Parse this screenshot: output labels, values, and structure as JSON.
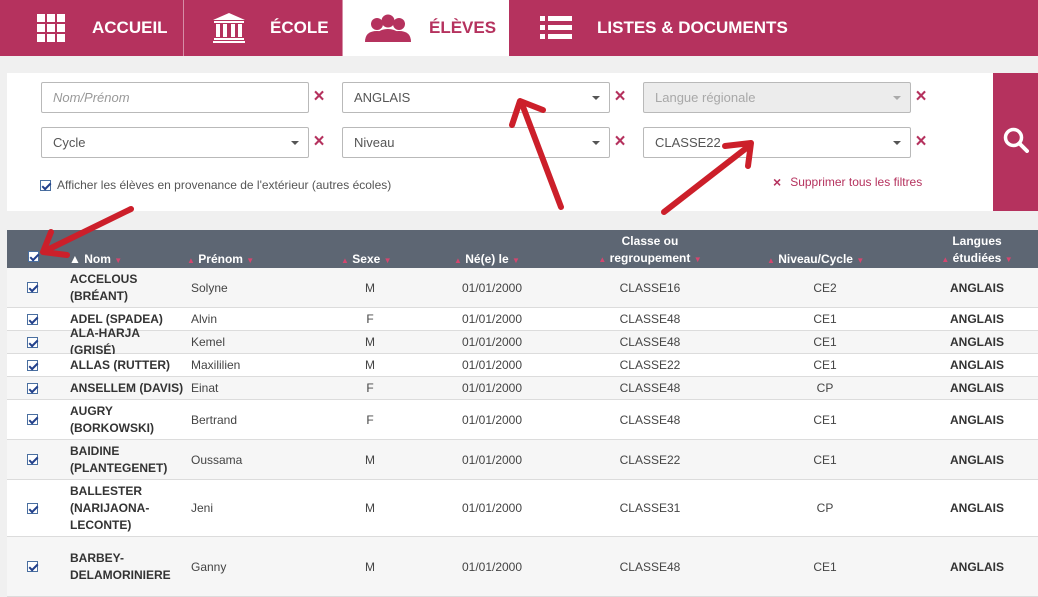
{
  "nav": {
    "tabs": [
      {
        "label": "ACCUEIL",
        "icon": "grid-icon"
      },
      {
        "label": "ÉCOLE",
        "icon": "school-building-icon"
      },
      {
        "label": "ÉLÈVES",
        "icon": "students-icon",
        "active": true
      },
      {
        "label": "LISTES & DOCUMENTS",
        "icon": "list-icon"
      }
    ]
  },
  "filters": {
    "name_placeholder": "Nom/Prénom",
    "language_value": "ANGLAIS",
    "regional_language_placeholder": "Langue régionale",
    "cycle_placeholder": "Cycle",
    "niveau_placeholder": "Niveau",
    "class_value": "CLASSE22",
    "external_label": "Afficher les élèves en provenance de l'extérieur (autres écoles)",
    "external_checked": true,
    "clear_all_label": "Supprimer tous les filtres"
  },
  "table": {
    "headers": {
      "nom": "Nom",
      "prenom": "Prénom",
      "sexe": "Sexe",
      "ne_le": "Né(e) le",
      "classe_line1": "Classe ou",
      "classe_line2": "regroupement",
      "niveau": "Niveau/Cycle",
      "langues_line1": "Langues",
      "langues_line2": "étudiées"
    },
    "rows": [
      {
        "nom": "ACCELOUS (BRÉANT)",
        "prenom": "Solyne",
        "sexe": "M",
        "ne_le": "01/01/2000",
        "classe": "CLASSE16",
        "niveau": "CE2",
        "langues": "ANGLAIS"
      },
      {
        "nom": "ADEL (SPADEA)",
        "prenom": "Alvin",
        "sexe": "F",
        "ne_le": "01/01/2000",
        "classe": "CLASSE48",
        "niveau": "CE1",
        "langues": "ANGLAIS"
      },
      {
        "nom": "ALA-HARJA (GRISÉ)",
        "prenom": "Kemel",
        "sexe": "M",
        "ne_le": "01/01/2000",
        "classe": "CLASSE48",
        "niveau": "CE1",
        "langues": "ANGLAIS"
      },
      {
        "nom": "ALLAS (RUTTER)",
        "prenom": "Maxililien",
        "sexe": "M",
        "ne_le": "01/01/2000",
        "classe": "CLASSE22",
        "niveau": "CE1",
        "langues": "ANGLAIS"
      },
      {
        "nom": "ANSELLEM (DAVIS)",
        "prenom": "Einat",
        "sexe": "F",
        "ne_le": "01/01/2000",
        "classe": "CLASSE48",
        "niveau": "CP",
        "langues": "ANGLAIS"
      },
      {
        "nom": "AUGRY (BORKOWSKI)",
        "prenom": "Bertrand",
        "sexe": "F",
        "ne_le": "01/01/2000",
        "classe": "CLASSE48",
        "niveau": "CE1",
        "langues": "ANGLAIS"
      },
      {
        "nom": "BAIDINE (PLANTEGENET)",
        "prenom": "Oussama",
        "sexe": "M",
        "ne_le": "01/01/2000",
        "classe": "CLASSE22",
        "niveau": "CE1",
        "langues": "ANGLAIS"
      },
      {
        "nom": "BALLESTER (NARIJAONA-LECONTE)",
        "prenom": "Jeni",
        "sexe": "M",
        "ne_le": "01/01/2000",
        "classe": "CLASSE31",
        "niveau": "CP",
        "langues": "ANGLAIS"
      },
      {
        "nom": "BARBEY-DELAMORINIERE",
        "prenom": "Ganny",
        "sexe": "M",
        "ne_le": "01/01/2000",
        "classe": "CLASSE48",
        "niveau": "CE1",
        "langues": "ANGLAIS"
      }
    ]
  },
  "colors": {
    "brand": "#b5325e",
    "header_bg": "#5d6673",
    "annotation_arrow": "#cc1f2a"
  }
}
